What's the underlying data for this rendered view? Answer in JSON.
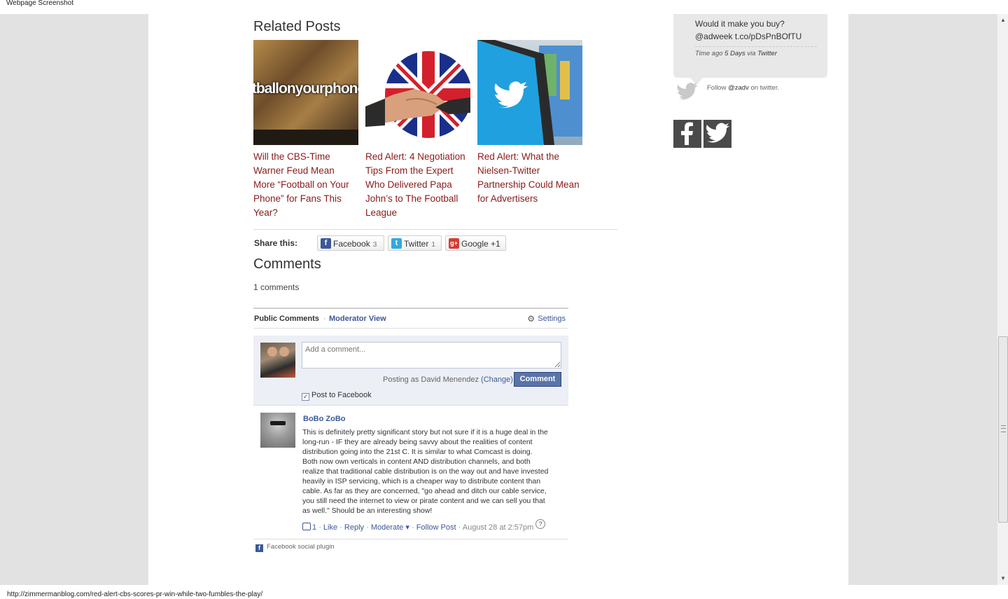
{
  "window": {
    "title": "Webpage Screenshot",
    "status_url": "http://zimmermanblog.com/red-alert-cbs-scores-pr-win-while-two-fumbles-the-play/"
  },
  "related": {
    "title": "Related Posts",
    "thumb1_text": "otballonyourphone",
    "posts": [
      {
        "title": "Will the CBS-Time Warner Feud Mean More “Football on Your Phone” for Fans This Year?"
      },
      {
        "title": "Red Alert: 4 Negotiation Tips From the Expert Who Delivered Papa John’s to The Football League"
      },
      {
        "title": "Red Alert: What the Nielsen-Twitter Partnership Could Mean for Advertisers"
      }
    ]
  },
  "share": {
    "label": "Share this:",
    "facebook": {
      "label": "Facebook",
      "count": "3"
    },
    "twitter": {
      "label": "Twitter",
      "count": "1"
    },
    "google": {
      "label": "Google +1"
    }
  },
  "comments": {
    "title": "Comments",
    "count_text": "1 comments"
  },
  "fb_plugin": {
    "tab_public": "Public Comments",
    "separator": "·",
    "tab_moderator": "Moderator View",
    "settings": "Settings",
    "input_placeholder": "Add a comment...",
    "posting_as": "Posting as David Menendez",
    "change": "(Change)",
    "comment_button": "Comment",
    "post_to_facebook": "Post to Facebook",
    "post_to_facebook_checked": true,
    "comment": {
      "author": "BoBo ZoBo",
      "body": "This is definitely pretty significant story but not sure if it is a huge deal in the long-run - IF they are already being savvy about the realities of content distribution going into the 21st C. It is similar to what Comcast is doing. Both now own verticals in content AND distribution channels, and both realize that traditional cable distribution is on the way out and have invested heavily in ISP servicing, which is a cheaper way to distribute content than cable. As far as they are concerned, \"go ahead and ditch our cable service, you still need the internet to view or pirate content and we can sell you that as well.\" Should be an interesting show!",
      "likes": "1",
      "like": "Like",
      "reply": "Reply",
      "moderate": "Moderate",
      "follow_post": "Follow Post",
      "date": "August 28 at 2:57pm"
    },
    "footer": "Facebook social plugin"
  },
  "sidebar": {
    "tweet_line1": "Would it make you buy?",
    "tweet_line2": "@adweek t.co/pDsPnBOfTU",
    "time_ago_label": "Time ago",
    "time_ago_value": "5 Days",
    "via_label": "via",
    "via_value": "Twitter",
    "follow_prefix": "Follow",
    "follow_handle": "@zadv",
    "follow_suffix": "on twitter."
  },
  "colors": {
    "link_red": "#8b1a1a",
    "facebook_blue": "#3b5998",
    "gutter_gray": "#e2e2e2",
    "social_tile": "#4a4a4a"
  }
}
